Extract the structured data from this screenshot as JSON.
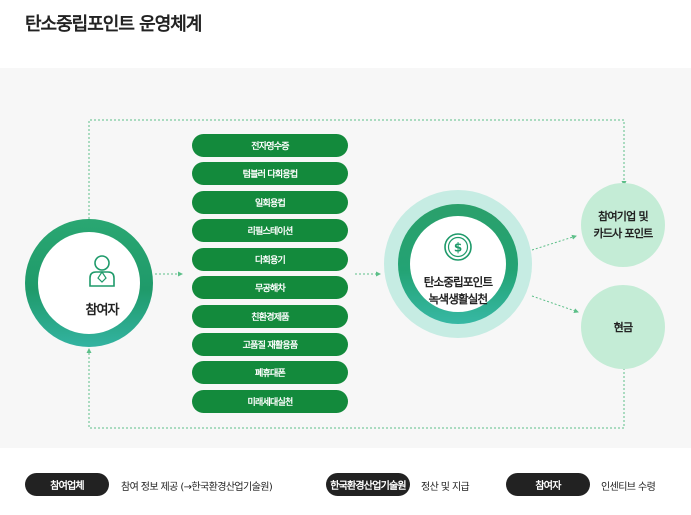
{
  "title": "탄소중립포인트 운영체계",
  "participant": {
    "label": "참여자",
    "icon": "person-icon"
  },
  "activities": [
    "전자영수증",
    "텀블러 다회용컵",
    "일회용컵",
    "리필스테이션",
    "다회용기",
    "무공해차",
    "친환경제품",
    "고품질 재활용품",
    "폐휴대폰",
    "미래세대실천"
  ],
  "hub": {
    "line1": "탄소중립포인트",
    "line2": "녹색생활실천",
    "icon": "coin-dollar-icon"
  },
  "outputs": {
    "partners": {
      "line1": "참여기업 및",
      "line2": "카드사 포인트"
    },
    "cash": "현금"
  },
  "legend": [
    {
      "badge": "참여업체",
      "text": "참여 정보 제공 (→한국환경산업기술원)"
    },
    {
      "badge": "한국환경산업기술원",
      "text": "정산 및 지급"
    },
    {
      "badge": "참여자",
      "text": "인센티브 수령"
    }
  ],
  "colors": {
    "pill": "#138a3c",
    "ring": "#23a374",
    "hub_halo": "#c6ece3",
    "output_fill": "#c4ecd6",
    "dotted": "#5cbf88",
    "badge": "#222222"
  }
}
